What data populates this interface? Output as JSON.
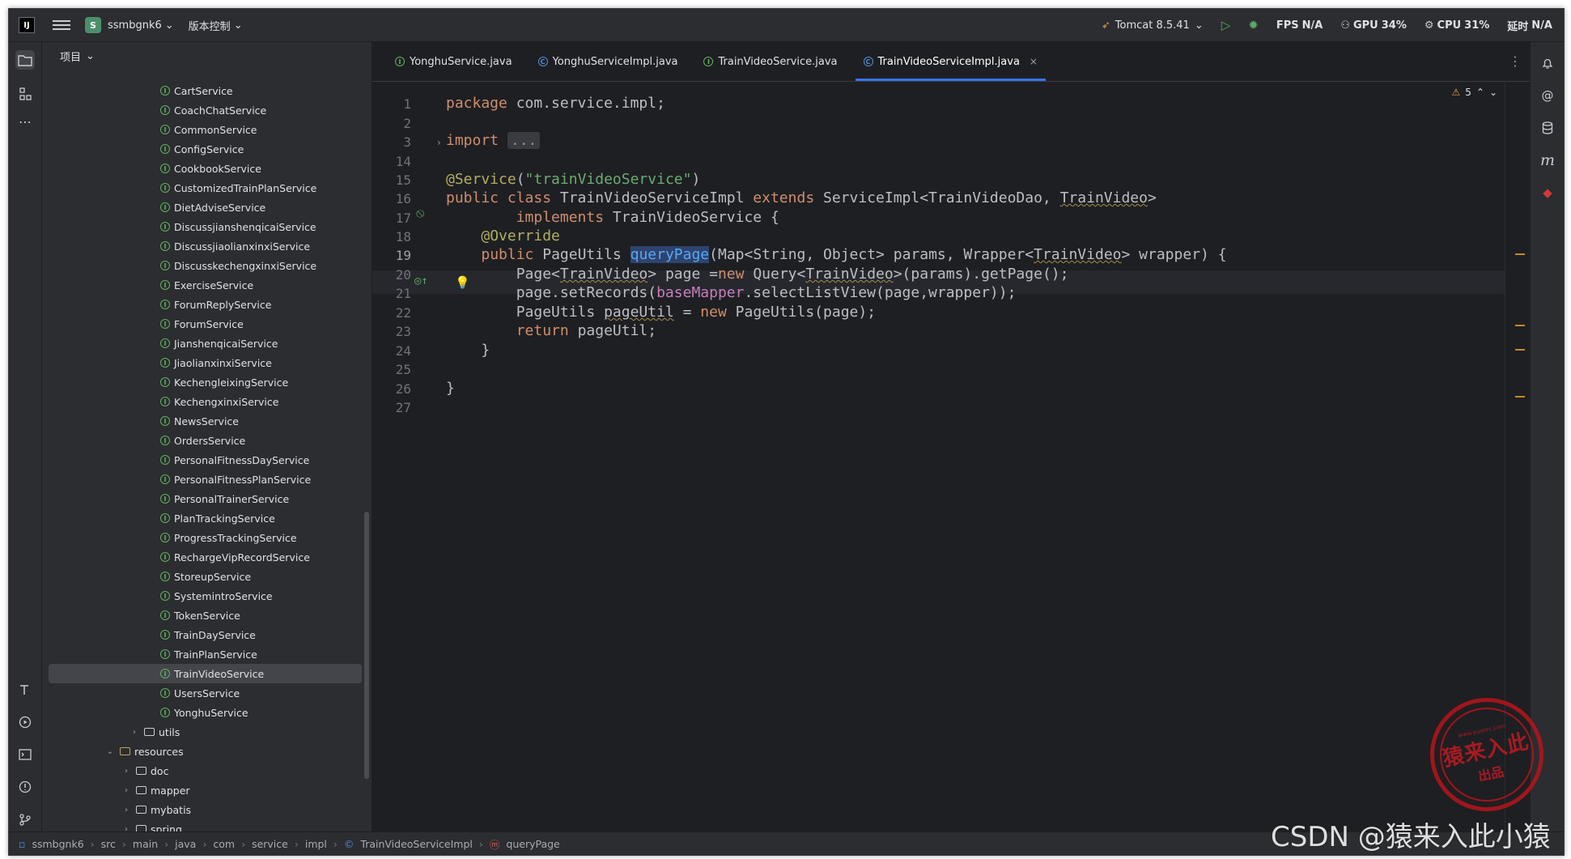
{
  "titlebar": {
    "project_letter": "S",
    "project_name": "ssmbgnk6",
    "vcs": "版本控制",
    "run_config": "Tomcat 8.5.41",
    "fps_label": "FPS",
    "fps_value": "N/A",
    "gpu_label": "GPU",
    "gpu_value": "34%",
    "cpu_label": "CPU",
    "cpu_value": "31%",
    "time_label": "延时",
    "time_value": "N/A"
  },
  "project_panel": {
    "header": "项目",
    "items": [
      {
        "type": "interface",
        "label": "CartService"
      },
      {
        "type": "interface",
        "label": "CoachChatService"
      },
      {
        "type": "interface",
        "label": "CommonService"
      },
      {
        "type": "interface",
        "label": "ConfigService"
      },
      {
        "type": "interface",
        "label": "CookbookService"
      },
      {
        "type": "interface",
        "label": "CustomizedTrainPlanService"
      },
      {
        "type": "interface",
        "label": "DietAdviseService"
      },
      {
        "type": "interface",
        "label": "DiscussjianshenqicaiService"
      },
      {
        "type": "interface",
        "label": "DiscussjiaolianxinxiService"
      },
      {
        "type": "interface",
        "label": "DiscusskechengxinxiService"
      },
      {
        "type": "interface",
        "label": "ExerciseService"
      },
      {
        "type": "interface",
        "label": "ForumReplyService"
      },
      {
        "type": "interface",
        "label": "ForumService"
      },
      {
        "type": "interface",
        "label": "JianshenqicaiService"
      },
      {
        "type": "interface",
        "label": "JiaolianxinxiService"
      },
      {
        "type": "interface",
        "label": "KechengleixingService"
      },
      {
        "type": "interface",
        "label": "KechengxinxiService"
      },
      {
        "type": "interface",
        "label": "NewsService"
      },
      {
        "type": "interface",
        "label": "OrdersService"
      },
      {
        "type": "interface",
        "label": "PersonalFitnessDayService"
      },
      {
        "type": "interface",
        "label": "PersonalFitnessPlanService"
      },
      {
        "type": "interface",
        "label": "PersonalTrainerService"
      },
      {
        "type": "interface",
        "label": "PlanTrackingService"
      },
      {
        "type": "interface",
        "label": "ProgressTrackingService"
      },
      {
        "type": "interface",
        "label": "RechargeVipRecordService"
      },
      {
        "type": "interface",
        "label": "StoreupService"
      },
      {
        "type": "interface",
        "label": "SystemintroService"
      },
      {
        "type": "interface",
        "label": "TokenService"
      },
      {
        "type": "interface",
        "label": "TrainDayService"
      },
      {
        "type": "interface",
        "label": "TrainPlanService"
      },
      {
        "type": "interface",
        "label": "TrainVideoService",
        "selected": true
      },
      {
        "type": "interface",
        "label": "UsersService"
      },
      {
        "type": "interface",
        "label": "YonghuService"
      },
      {
        "type": "folder",
        "label": "utils",
        "expanded": false
      },
      {
        "type": "resfolder",
        "label": "resources",
        "expanded": true
      },
      {
        "type": "folder",
        "label": "doc",
        "expanded": false
      },
      {
        "type": "folder",
        "label": "mapper",
        "expanded": false
      },
      {
        "type": "folder",
        "label": "mybatis",
        "expanded": false
      },
      {
        "type": "folder",
        "label": "spring",
        "expanded": false
      }
    ]
  },
  "tabs": [
    {
      "label": "YonghuService.java",
      "kind": "interface"
    },
    {
      "label": "YonghuServiceImpl.java",
      "kind": "class"
    },
    {
      "label": "TrainVideoService.java",
      "kind": "interface"
    },
    {
      "label": "TrainVideoServiceImpl.java",
      "kind": "class",
      "active": true
    }
  ],
  "editor": {
    "warnings_count": "5",
    "line_numbers": [
      "1",
      "2",
      "3",
      "14",
      "15",
      "16",
      "17",
      "18",
      "19",
      "20",
      "21",
      "22",
      "23",
      "24",
      "25",
      "26",
      "27"
    ]
  },
  "breadcrumbs": [
    "ssmbgnk6",
    "src",
    "main",
    "java",
    "com",
    "service",
    "impl",
    "TrainVideoServiceImpl",
    "queryPage"
  ],
  "watermark": {
    "stamp_url": "www.yuanrc.com",
    "stamp_main": "猿来入此",
    "stamp_sub": "出品",
    "csdn_text": "CSDN @猿来入此小猿"
  },
  "colors": {
    "accent": "#3574f0",
    "keyword": "#cf8e6d",
    "string": "#6aab73",
    "annotation": "#b3ae60",
    "method": "#56a8f5",
    "field": "#c77dbb",
    "stamp_red": "#b8141a"
  },
  "icons": {
    "left_strip": [
      "folder-icon",
      "structure-icon",
      "more-icon",
      "build-icon",
      "run-icon",
      "terminal-icon",
      "problems-icon",
      "git-icon"
    ],
    "right_strip": [
      "notifications-icon",
      "ai-assistant-icon",
      "database-icon",
      "maven-icon",
      "plugin-icon"
    ]
  }
}
